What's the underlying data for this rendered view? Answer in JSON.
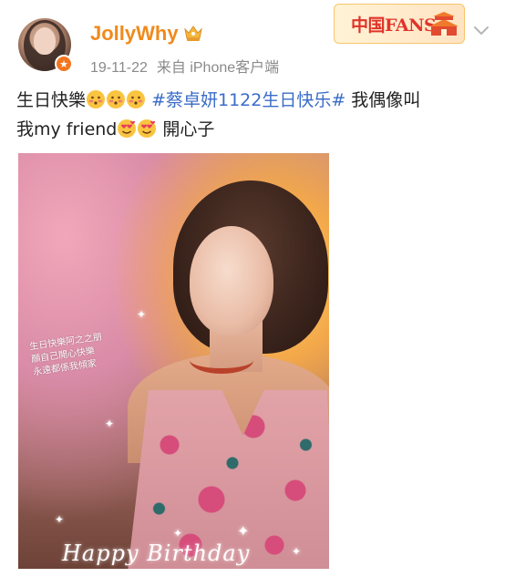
{
  "header": {
    "username": "JollyWhy",
    "date": "19-11-22",
    "source_prefix": "来自",
    "source": "iPhone客户端",
    "fans_badge_text": "中国FANS"
  },
  "post": {
    "line1_text": "生日快樂",
    "hashtag": "#蔡卓妍1122生日快乐#",
    "line1_suffix": " 我偶像叫",
    "line2_prefix": "我my friend",
    "line2_suffix": " 開心子"
  },
  "photo": {
    "handwritten_lines": [
      "生日快樂阿之之朋",
      "願自己開心快樂",
      "永遠都係我傾家"
    ],
    "caption": "Happy Birthday"
  },
  "icons": {
    "avatar": "avatar",
    "verified": "verified-badge-icon",
    "crown": "crown-icon",
    "chevron": "chevron-down-icon",
    "emoji_blush": "blush-emoji-icon",
    "emoji_love": "smiling-face-hearts-emoji-icon"
  },
  "colors": {
    "username": "#f08a1c",
    "hashtag": "#3a6cc7",
    "meta": "#8a8a8a",
    "fans_text": "#e0342a"
  }
}
